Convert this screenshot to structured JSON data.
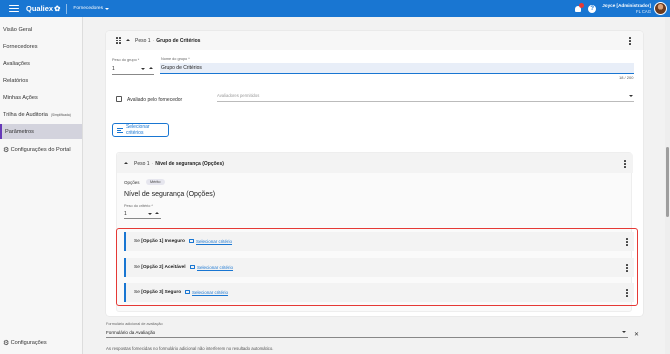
{
  "topbar": {
    "logo": "Qualiex",
    "module": "Fornecedores",
    "user_name": "Joyce [Administrador]",
    "user_sub": "FL CAG",
    "icons": [
      "menu-icon",
      "gear-icon",
      "bell-icon",
      "help-icon"
    ]
  },
  "sidebar": {
    "items": [
      {
        "label": "Visão Geral"
      },
      {
        "label": "Fornecedores"
      },
      {
        "label": "Avaliações"
      },
      {
        "label": "Relatórios"
      },
      {
        "label": "Minhas Ações"
      },
      {
        "label": "Trilha de Auditoria",
        "tag": "(Simplificada)"
      },
      {
        "label": "Parâmetros",
        "active": true
      },
      {
        "label": "Configurações do Portal"
      }
    ],
    "footer": "Configurações"
  },
  "group": {
    "weight_prefix": "Peso 1",
    "title": "Grupo de Critérios",
    "weight_label": "Peso do grupo *",
    "weight_value": "1",
    "name_label": "Nome do grupo *",
    "name_value": "Grupo de Critérios",
    "counter": "18 / 200",
    "evaluated_label": "Avaliado pelo fornecedor",
    "evaluators_placeholder": "Avaliadores permitidos",
    "select_criteria_button": "Selecionar critérios"
  },
  "criterion": {
    "weight_prefix": "Peso 1",
    "title": "Nível de segurança (Opções)",
    "type_label": "Opções",
    "chip": "Mérito",
    "heading": "Nível de segurança (Opções)",
    "weight_label": "Peso do critério *",
    "weight_value": "1",
    "options": [
      {
        "prefix": "Se",
        "option": "[Opção 1] Inseguro",
        "link": "Selecionar critério"
      },
      {
        "prefix": "Se",
        "option": "[Opção 2] Aceitável",
        "link": "Selecionar critério"
      },
      {
        "prefix": "Se",
        "option": "[Opção 3] Seguro",
        "link": "Selecionar critério"
      }
    ]
  },
  "footer_form": {
    "label": "Formulário adicional de avaliação",
    "value": "Formulário da Avaliação",
    "hint": "As respostas fornecidas no formulário adicional não interferem no resultado automático."
  },
  "colors": {
    "primary": "#1976d2",
    "highlight": "#e53935",
    "active_nav": "#673ab7"
  }
}
